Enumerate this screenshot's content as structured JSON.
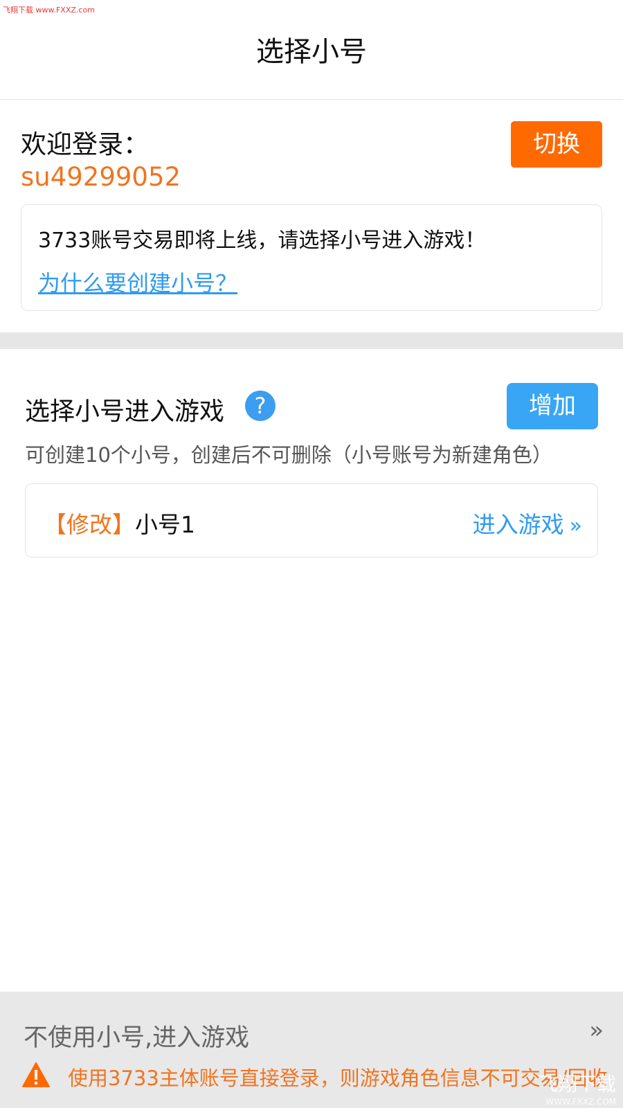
{
  "watermark_top": "飞翔下载 www.FXXZ.com",
  "header": {
    "title": "选择小号"
  },
  "welcome": {
    "label": "欢迎登录：",
    "username": "su49299052",
    "switch_label": "切换"
  },
  "notice": {
    "text": "3733账号交易即将上线，请选择小号进入游戏！",
    "link": "为什么要创建小号？"
  },
  "section": {
    "title": "选择小号进入游戏",
    "help_icon": "question-circle-icon",
    "help_glyph": "?",
    "add_label": "增加",
    "subtitle": "可创建10个小号，创建后不可删除（小号账号为新建角色）"
  },
  "accounts": [
    {
      "modify_label": "【修改】",
      "name": "小号1",
      "enter_label": "进入游戏",
      "chevron": "»"
    }
  ],
  "bottom": {
    "no_sub_label": "不使用小号,进入游戏",
    "chevron": "»",
    "warning_icon": "warning-triangle-icon",
    "warning_text": "使用3733主体账号直接登录，则游戏角色信息不可交易/回收"
  },
  "watermark_bottom": {
    "brand": "飞翔下载",
    "url": "WWW.FXXZ.COM"
  },
  "colors": {
    "orange": "#ff6a00",
    "blue": "#38a6f5",
    "link_blue": "#2f9bf0",
    "accent_orange_text": "#f07420"
  }
}
